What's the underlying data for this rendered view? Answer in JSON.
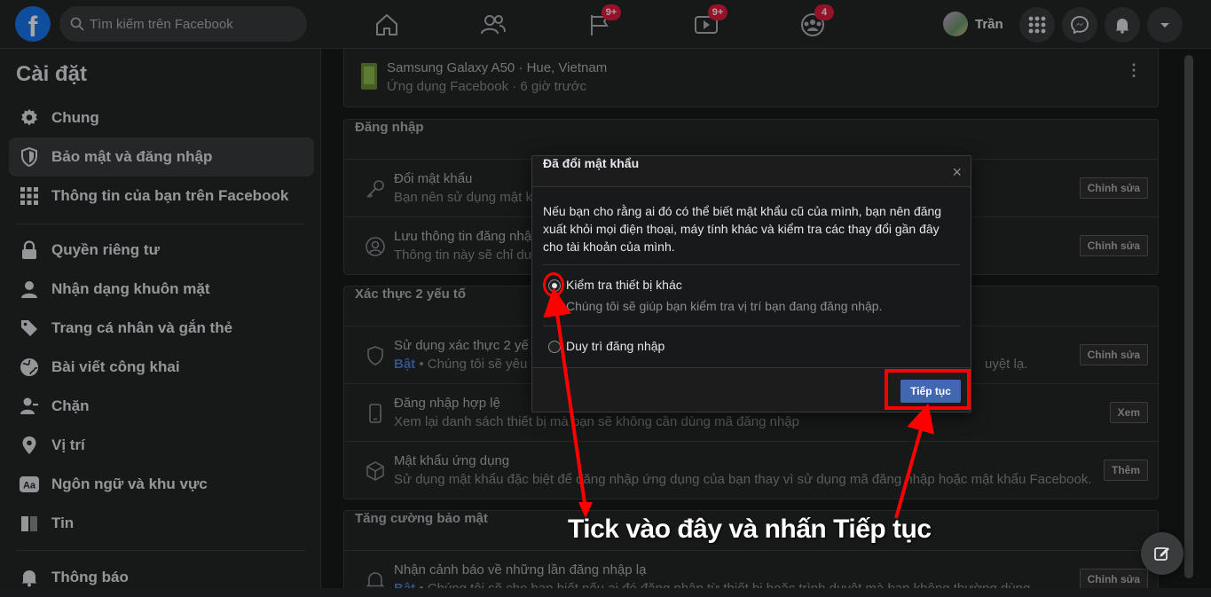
{
  "topbar": {
    "logo": "f",
    "search_placeholder": "Tìm kiếm trên Facebook",
    "badges": {
      "watch": "9+",
      "video": "9+",
      "groups": "4"
    },
    "profile_name": "Trần"
  },
  "sidebar": {
    "title": "Cài đặt",
    "items": [
      {
        "label": "Chung",
        "icon": "gear-icon"
      },
      {
        "label": "Bảo mật và đăng nhập",
        "icon": "shield-icon",
        "active": true
      },
      {
        "label": "Thông tin của bạn trên Facebook",
        "icon": "grid-icon"
      },
      {
        "label": "Quyền riêng tư",
        "icon": "lock-icon"
      },
      {
        "label": "Nhận dạng khuôn mặt",
        "icon": "face-icon"
      },
      {
        "label": "Trang cá nhân và gắn thẻ",
        "icon": "tag-icon"
      },
      {
        "label": "Bài viết công khai",
        "icon": "globe-icon"
      },
      {
        "label": "Chặn",
        "icon": "block-user-icon"
      },
      {
        "label": "Vị trí",
        "icon": "location-pin-icon"
      },
      {
        "label": "Ngôn ngữ và khu vực",
        "icon": "language-icon"
      },
      {
        "label": "Tin",
        "icon": "book-icon"
      },
      {
        "label": "Thông báo",
        "icon": "bell-icon"
      }
    ]
  },
  "main": {
    "device": {
      "title": "Samsung Galaxy A50 · Hue, Vietnam",
      "subtitle": "Ứng dụng Facebook · 6 giờ trước"
    },
    "login": {
      "header": "Đăng nhập",
      "rows": [
        {
          "title": "Đổi mật khẩu",
          "desc": "Bạn nên sử dụng mật k",
          "button": "Chỉnh sửa"
        },
        {
          "title": "Lưu thông tin đăng nhậ",
          "desc": "Thông tin này sẽ chỉ dư",
          "button": "Chỉnh sửa"
        }
      ]
    },
    "twofa": {
      "header": "Xác thực 2 yếu tố",
      "rows": [
        {
          "title": "Sử dụng xác thực 2 yế",
          "badge": "Bật",
          "desc": " • Chúng tôi sẽ yêu c",
          "tail": "uyệt lạ.",
          "button": "Chỉnh sửa"
        },
        {
          "title": "Đăng nhập hợp lệ",
          "desc": "Xem lại danh sách thiết bị mà bạn sẽ không cần dùng mã đăng nhập",
          "button": "Xem"
        },
        {
          "title": "Mật khẩu ứng dụng",
          "desc": "Sử dụng mật khẩu đặc biệt để đăng nhập ứng dụng của bạn thay vì sử dụng mã đăng nhập hoặc mật khẩu Facebook.",
          "button": "Thêm"
        }
      ]
    },
    "extra": {
      "header": "Tăng cường bảo mật",
      "rows": [
        {
          "title": "Nhận cảnh báo về những lần đăng nhập lạ",
          "badge": "Bật",
          "desc": " • Chúng tôi sẽ cho bạn biết nếu ai đó đăng nhập từ thiết bị hoặc trình duyệt mà bạn không thường dùng",
          "button": "Chỉnh sửa"
        }
      ]
    }
  },
  "dialog": {
    "title": "Đã đổi mật khẩu",
    "close": "×",
    "message": "Nếu bạn cho rằng ai đó có thể biết mật khẩu cũ của mình, bạn nên đăng xuất khỏi mọi điện thoại, máy tính khác và kiểm tra các thay đổi gần đây cho tài khoản của mình.",
    "options": [
      {
        "label": "Kiểm tra thiết bị khác",
        "desc": "Chúng tôi sẽ giúp bạn kiểm tra vị trí bạn đang đăng nhập.",
        "selected": true
      },
      {
        "label": "Duy trì đăng nhập",
        "desc": "",
        "selected": false
      }
    ],
    "continue_button": "Tiếp tục"
  },
  "annotation": {
    "text": "Tick vào đây và nhấn Tiếp tục",
    "color": "#ff0000"
  }
}
